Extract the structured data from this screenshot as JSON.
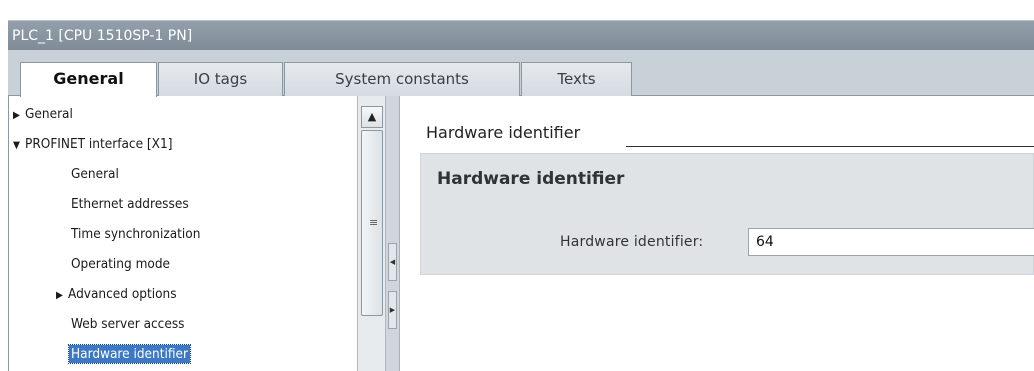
{
  "window": {
    "title": "PLC_1 [CPU 1510SP-1 PN]"
  },
  "tabs": [
    {
      "label": "General",
      "active": true
    },
    {
      "label": "IO tags",
      "active": false
    },
    {
      "label": "System constants",
      "active": false
    },
    {
      "label": "Texts",
      "active": false
    }
  ],
  "nav": {
    "items": [
      {
        "label": "General",
        "toggle": "▶"
      },
      {
        "label": "PROFINET interface [X1]",
        "toggle": "▼"
      },
      {
        "label": "General"
      },
      {
        "label": "Ethernet addresses"
      },
      {
        "label": "Time synchronization"
      },
      {
        "label": "Operating mode"
      },
      {
        "label": "Advanced options",
        "toggle": "▶"
      },
      {
        "label": "Web server access"
      },
      {
        "label": "Hardware identifier",
        "selected": true
      }
    ]
  },
  "scrollbar": {
    "up_icon": "▲",
    "grip": "≡"
  },
  "splitter": {
    "left_icon": "◀",
    "right_icon": "▶"
  },
  "content": {
    "section_title": "Hardware identifier",
    "group_title": "Hardware identifier",
    "field_label": "Hardware identifier:",
    "field_value": "64"
  }
}
